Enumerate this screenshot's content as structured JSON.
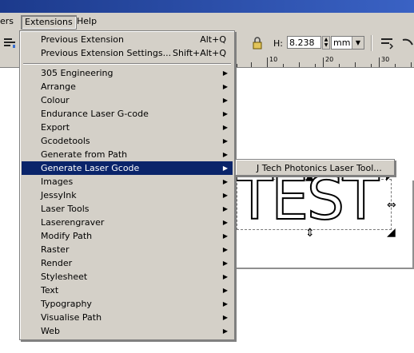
{
  "menubar": {
    "items": [
      {
        "label": "ers"
      },
      {
        "label": "Extensions"
      },
      {
        "label": "Help"
      }
    ]
  },
  "toolbar": {
    "h_label": "H:",
    "h_value": "8.238",
    "unit": "mm",
    "unit_arrow": "▼",
    "spin_up": "▲",
    "spin_down": "▼"
  },
  "ruler": {
    "numbers": [
      "10",
      "20",
      "30"
    ]
  },
  "menu": {
    "items": [
      {
        "label": "Previous Extension",
        "shortcut": "Alt+Q"
      },
      {
        "label": "Previous Extension Settings...",
        "shortcut": "Shift+Alt+Q"
      },
      {
        "label": "305 Engineering",
        "submenu_arrow": "▶"
      },
      {
        "label": "Arrange",
        "submenu_arrow": "▶"
      },
      {
        "label": "Colour",
        "submenu_arrow": "▶"
      },
      {
        "label": "Endurance Laser G-code",
        "submenu_arrow": "▶"
      },
      {
        "label": "Export",
        "submenu_arrow": "▶"
      },
      {
        "label": "Gcodetools",
        "submenu_arrow": "▶"
      },
      {
        "label": "Generate from Path",
        "submenu_arrow": "▶"
      },
      {
        "label": "Generate Laser Gcode",
        "submenu_arrow": "▶"
      },
      {
        "label": "Images",
        "submenu_arrow": "▶"
      },
      {
        "label": "JessyInk",
        "submenu_arrow": "▶"
      },
      {
        "label": "Laser Tools",
        "submenu_arrow": "▶"
      },
      {
        "label": "Laserengraver",
        "submenu_arrow": "▶"
      },
      {
        "label": "Modify Path",
        "submenu_arrow": "▶"
      },
      {
        "label": "Raster",
        "submenu_arrow": "▶"
      },
      {
        "label": "Render",
        "submenu_arrow": "▶"
      },
      {
        "label": "Stylesheet",
        "submenu_arrow": "▶"
      },
      {
        "label": "Text",
        "submenu_arrow": "▶"
      },
      {
        "label": "Typography",
        "submenu_arrow": "▶"
      },
      {
        "label": "Visualise Path",
        "submenu_arrow": "▶"
      },
      {
        "label": "Web",
        "submenu_arrow": "▶"
      }
    ]
  },
  "submenu": {
    "items": [
      {
        "label": "J Tech Photonics Laser Tool..."
      }
    ]
  },
  "canvas": {
    "text": "TEST"
  },
  "colors": {
    "highlight": "#0a246a",
    "menu_bg": "#d4d0c8",
    "title_bar": "#2a4aa8"
  }
}
